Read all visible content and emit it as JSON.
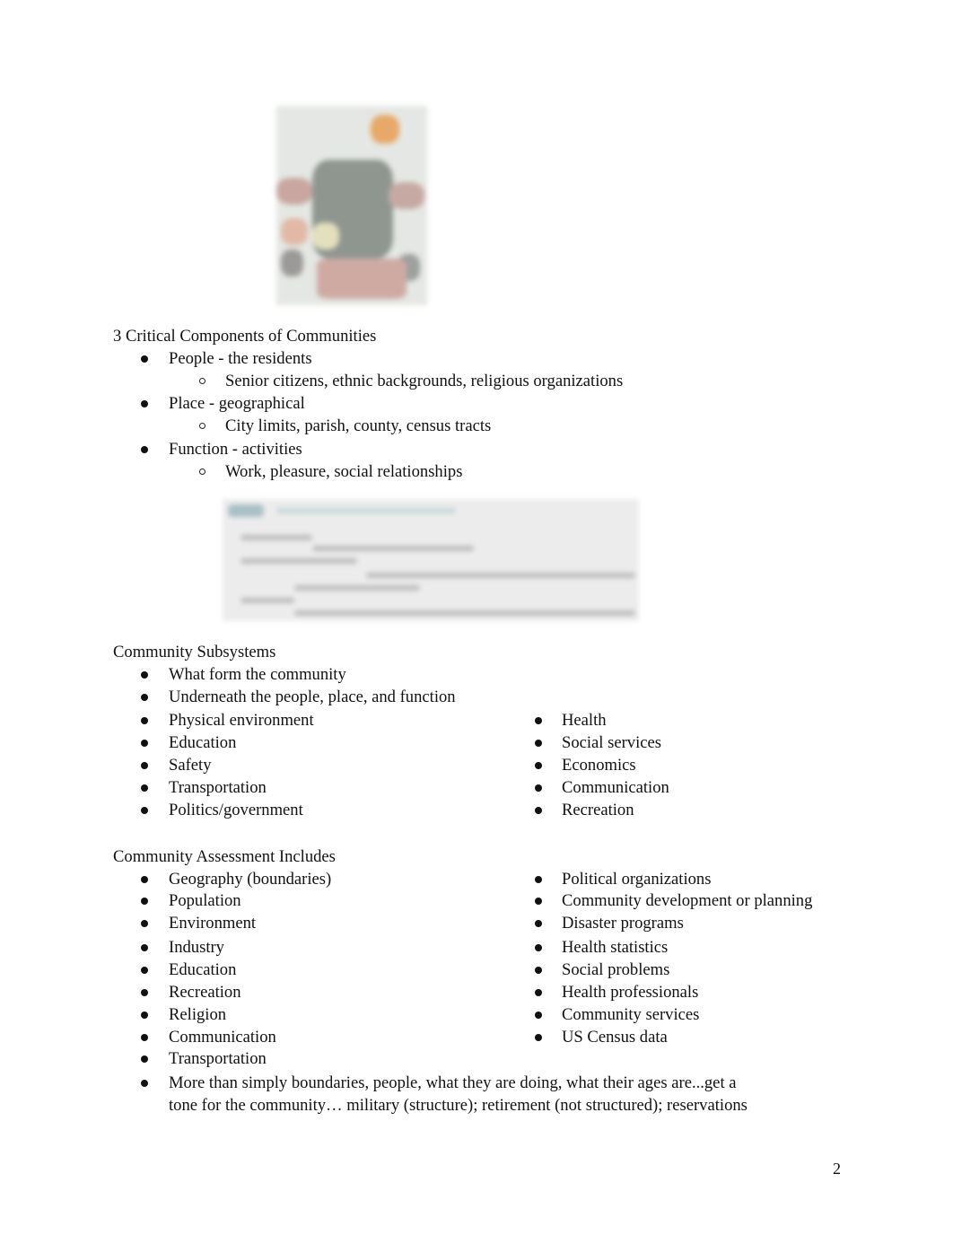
{
  "page_number": "2",
  "images": {
    "poster": {
      "description": "blurred community poster illustration"
    },
    "table": {
      "description": "blurred screenshot of a table"
    }
  },
  "critical_components": {
    "heading": "3 Critical Components of Communities",
    "items": [
      {
        "term": "People",
        "desc": " - the residents",
        "sub": "Senior citizens, ethnic backgrounds, religious organizations"
      },
      {
        "term": "Place",
        "desc": " - geographical",
        "sub": "City limits, parish, county, census tracts"
      },
      {
        "term": "Function",
        "desc": " - activities",
        "sub": "Work, pleasure, social relationships"
      }
    ]
  },
  "subsystems": {
    "heading": "Community Subsystems",
    "intro": [
      "What form the community",
      "Underneath the people, place, and function"
    ],
    "left": [
      "Physical environment",
      "Education",
      "Safety",
      "Transportation",
      "Politics/government"
    ],
    "right": [
      "Health",
      "Social services",
      "Economics",
      "Communication",
      "Recreation"
    ]
  },
  "assessment": {
    "heading": "Community Assessment Includes",
    "left": [
      "Geography (boundaries)",
      "Population",
      "Environment",
      "Industry",
      "Education",
      "Recreation",
      "Religion",
      "Communication",
      "Transportation"
    ],
    "right": [
      "Political organizations",
      "Community development or planning",
      "Disaster programs",
      "Health statistics",
      "Social problems",
      "Health professionals",
      "Community services",
      "US Census data"
    ],
    "note_line1": "More than simply boundaries, people, what they are doing, what their ages are...get a",
    "note_line2": "tone for the community… military (structure); retirement (not structured); reservations"
  }
}
